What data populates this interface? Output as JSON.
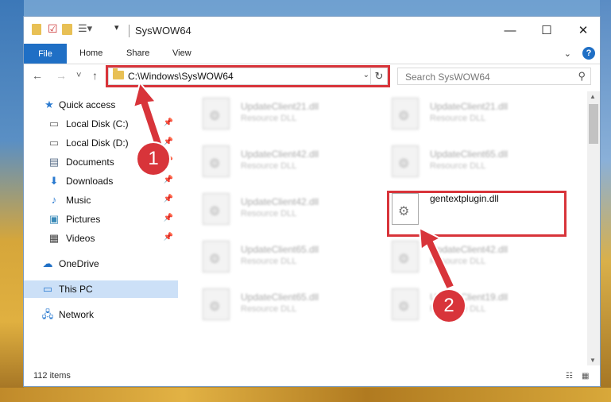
{
  "window": {
    "title": "SysWOW64",
    "quick_access_toolbar": [
      "folder-icon",
      "properties-icon",
      "new-folder-icon",
      "customize-icon"
    ],
    "controls": {
      "minimize": "—",
      "maximize": "☐",
      "close": "✕"
    }
  },
  "ribbon": {
    "file_tab": "File",
    "tabs": [
      "Home",
      "Share",
      "View"
    ],
    "expand_icon": "⌄",
    "help_label": "?"
  },
  "navigation": {
    "back": "←",
    "forward": "→",
    "recent": "˅",
    "up": "↑",
    "address": "C:\\Windows\\SysWOW64",
    "search_placeholder": "Search SysWOW64"
  },
  "sidebar": {
    "quick_access": "Quick access",
    "items": [
      {
        "label": "Local Disk (C:)",
        "icon": "drive-icon"
      },
      {
        "label": "Local Disk (D:)",
        "icon": "drive-icon"
      },
      {
        "label": "Documents",
        "icon": "document-icon"
      },
      {
        "label": "Downloads",
        "icon": "download-icon"
      },
      {
        "label": "Music",
        "icon": "music-icon"
      },
      {
        "label": "Pictures",
        "icon": "pictures-icon"
      },
      {
        "label": "Videos",
        "icon": "videos-icon"
      }
    ],
    "onedrive": "OneDrive",
    "this_pc": "This PC",
    "network": "Network"
  },
  "files": [
    {
      "name": "UpdateClient21.dll",
      "type": "Resource DLL"
    },
    {
      "name": "UpdateClient21.dll",
      "type": "Resource DLL"
    },
    {
      "name": "UpdateClient42.dll",
      "type": "Resource DLL"
    },
    {
      "name": "UpdateClient65.dll",
      "type": "Resource DLL"
    },
    {
      "name": "UpdateClient42.dll",
      "type": "Resource DLL"
    },
    {
      "name": "gentextplugin.dll",
      "type": ""
    },
    {
      "name": "UpdateClient65.dll",
      "type": "Resource DLL"
    },
    {
      "name": "UpdateClient42.dll",
      "type": "Resource DLL"
    },
    {
      "name": "UpdateClient65.dll",
      "type": "Resource DLL"
    },
    {
      "name": "UpdateClient19.dll",
      "type": "Resource DLL"
    }
  ],
  "status": {
    "item_count": "112 items"
  },
  "annotations": {
    "step1": "1",
    "step2": "2",
    "color": "#d8343a"
  }
}
